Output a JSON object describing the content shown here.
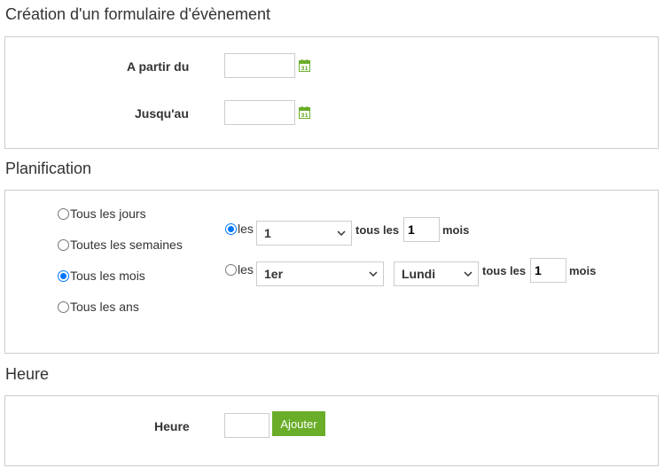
{
  "event_section": {
    "title": "Création d'un formulaire d'évènement",
    "from_label": "A partir du",
    "from_value": "",
    "to_label": "Jusqu'au",
    "to_value": ""
  },
  "planning_section": {
    "title": "Planification",
    "frequency_options": [
      {
        "label": "Tous les jours",
        "checked": false
      },
      {
        "label": "Toutes les semaines",
        "checked": false
      },
      {
        "label": "Tous les mois",
        "checked": true
      },
      {
        "label": "Tous les ans",
        "checked": false
      }
    ],
    "monthly_row1": {
      "radio_label": "les",
      "checked": true,
      "day_select": "1",
      "every_label": "tous les",
      "interval_value": "1",
      "unit_label": "mois"
    },
    "monthly_row2": {
      "radio_label": "les",
      "checked": false,
      "ordinal_select": "1er",
      "weekday_select": "Lundi",
      "every_label": "tous les",
      "interval_value": "1",
      "unit_label": "mois"
    }
  },
  "time_section": {
    "title": "Heure",
    "time_label": "Heure",
    "time_value": "",
    "add_button": "Ajouter"
  },
  "colors": {
    "accent_green": "#6aad29",
    "radio_blue": "#0075ff",
    "border": "#cccccc"
  },
  "icons": {
    "calendar": "calendar-icon",
    "dropdown": "chevron-down-icon"
  }
}
